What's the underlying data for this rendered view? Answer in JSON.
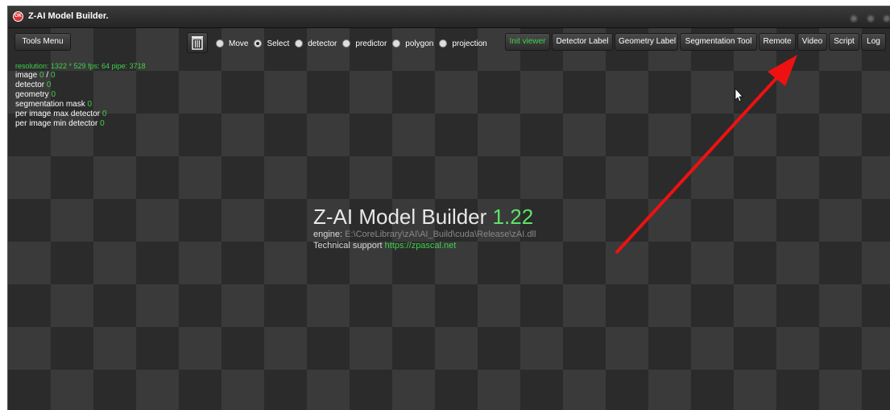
{
  "window": {
    "title": "Z-AI Model Builder.",
    "icon_text": "OK"
  },
  "toolbar": {
    "tools_menu": "Tools Menu",
    "modes": [
      {
        "label": "Move",
        "checked": false
      },
      {
        "label": "Select",
        "checked": true
      },
      {
        "label": "detector",
        "checked": false
      },
      {
        "label": "predictor",
        "checked": false
      },
      {
        "label": "polygon",
        "checked": false
      },
      {
        "label": "projection",
        "checked": false
      }
    ],
    "buttons": {
      "init_viewer": "Init viewer",
      "detector_label": "Detector Label",
      "geometry_label": "Geometry Label",
      "segmentation_tool": "Segmentation Tool",
      "remote": "Remote",
      "video": "Video",
      "script": "Script",
      "log": "Log"
    }
  },
  "stats": {
    "status_line": "resolution: 1322 * 529 fps: 64 pipe: 3718",
    "image_label": "image",
    "image_current": "0",
    "image_sep": "/",
    "image_total": "0",
    "detector_label": "detector",
    "detector_value": "0",
    "geometry_label": "geometry",
    "geometry_value": "0",
    "segmentation_label": "segmentation mask",
    "segmentation_value": "0",
    "max_detector_label": "per image max detector",
    "max_detector_value": "0",
    "min_detector_label": "per image min detector",
    "min_detector_value": "0"
  },
  "splash": {
    "name": "Z-AI Model Builder",
    "version": "1.22",
    "engine_label": "engine:",
    "engine_path": "E:\\CoreLibrary\\zAI\\AI_Build\\cuda\\Release\\zAI.dll",
    "support_label": "Technical support",
    "support_url": "https://zpascal.net"
  },
  "colors": {
    "accent_green": "#3dd24a",
    "annotation_arrow": "#ee1111"
  }
}
